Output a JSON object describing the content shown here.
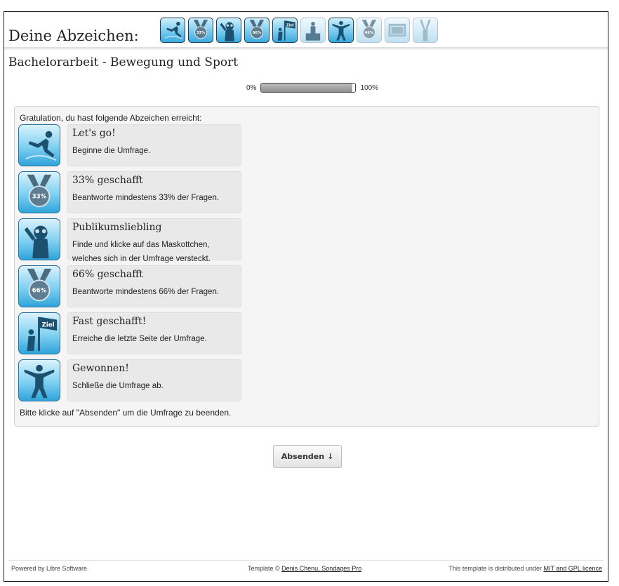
{
  "header": {
    "title": "Deine Abzeichen:",
    "badges": [
      {
        "icon": "runner-start-icon",
        "earned": true
      },
      {
        "icon": "medal-33-icon",
        "label": "33%",
        "earned": true
      },
      {
        "icon": "mascot-icon",
        "earned": true
      },
      {
        "icon": "medal-66-icon",
        "label": "66%",
        "earned": true
      },
      {
        "icon": "finish-flag-icon",
        "label": "Ziel",
        "earned": true
      },
      {
        "icon": "podium-icon",
        "earned": false
      },
      {
        "icon": "finish-line-icon",
        "earned": true
      },
      {
        "icon": "medal-locked-icon",
        "label": "66%",
        "earned": false
      },
      {
        "icon": "ticket-icon",
        "earned": false
      },
      {
        "icon": "cheering-arms-icon",
        "earned": false
      }
    ]
  },
  "survey": {
    "title": "Bachelorarbeit - Bewegung und Sport",
    "progress": {
      "min_label": "0%",
      "max_label": "100%",
      "value": 0.97
    }
  },
  "panel": {
    "intro": "Gratulation, du hast folgende Abzeichen erreicht:",
    "achievements": [
      {
        "icon": "runner-start-icon",
        "title": "Let's go!",
        "description": "Beginne die Umfrage."
      },
      {
        "icon": "medal-33-icon",
        "icon_label": "33%",
        "title": "33% geschafft",
        "description": "Beantworte mindestens 33% der Fragen."
      },
      {
        "icon": "mascot-icon",
        "title": "Publikumsliebling",
        "description": "Finde und klicke auf das Maskottchen, welches sich in der Umfrage versteckt."
      },
      {
        "icon": "medal-66-icon",
        "icon_label": "66%",
        "title": "66% geschafft",
        "description": "Beantworte mindestens 66% der Fragen."
      },
      {
        "icon": "finish-flag-icon",
        "icon_label": "Ziel",
        "title": "Fast geschafft!",
        "description": "Erreiche die letzte Seite der Umfrage."
      },
      {
        "icon": "finish-line-icon",
        "title": "Gewonnen!",
        "description": "Schließe die Umfrage ab."
      }
    ],
    "outro": "Bitte klicke auf \"Absenden\" um die Umfrage zu beenden."
  },
  "submit": {
    "label": "Absenden",
    "icon_glyph": "↓"
  },
  "footer": {
    "left": "Powered by Libre Software",
    "mid_prefix": "Template © ",
    "mid_link": "Denis Chenu, Sondages Pro",
    "right_prefix": "This template is distributed under ",
    "right_link": "MIT and GPL licence"
  }
}
